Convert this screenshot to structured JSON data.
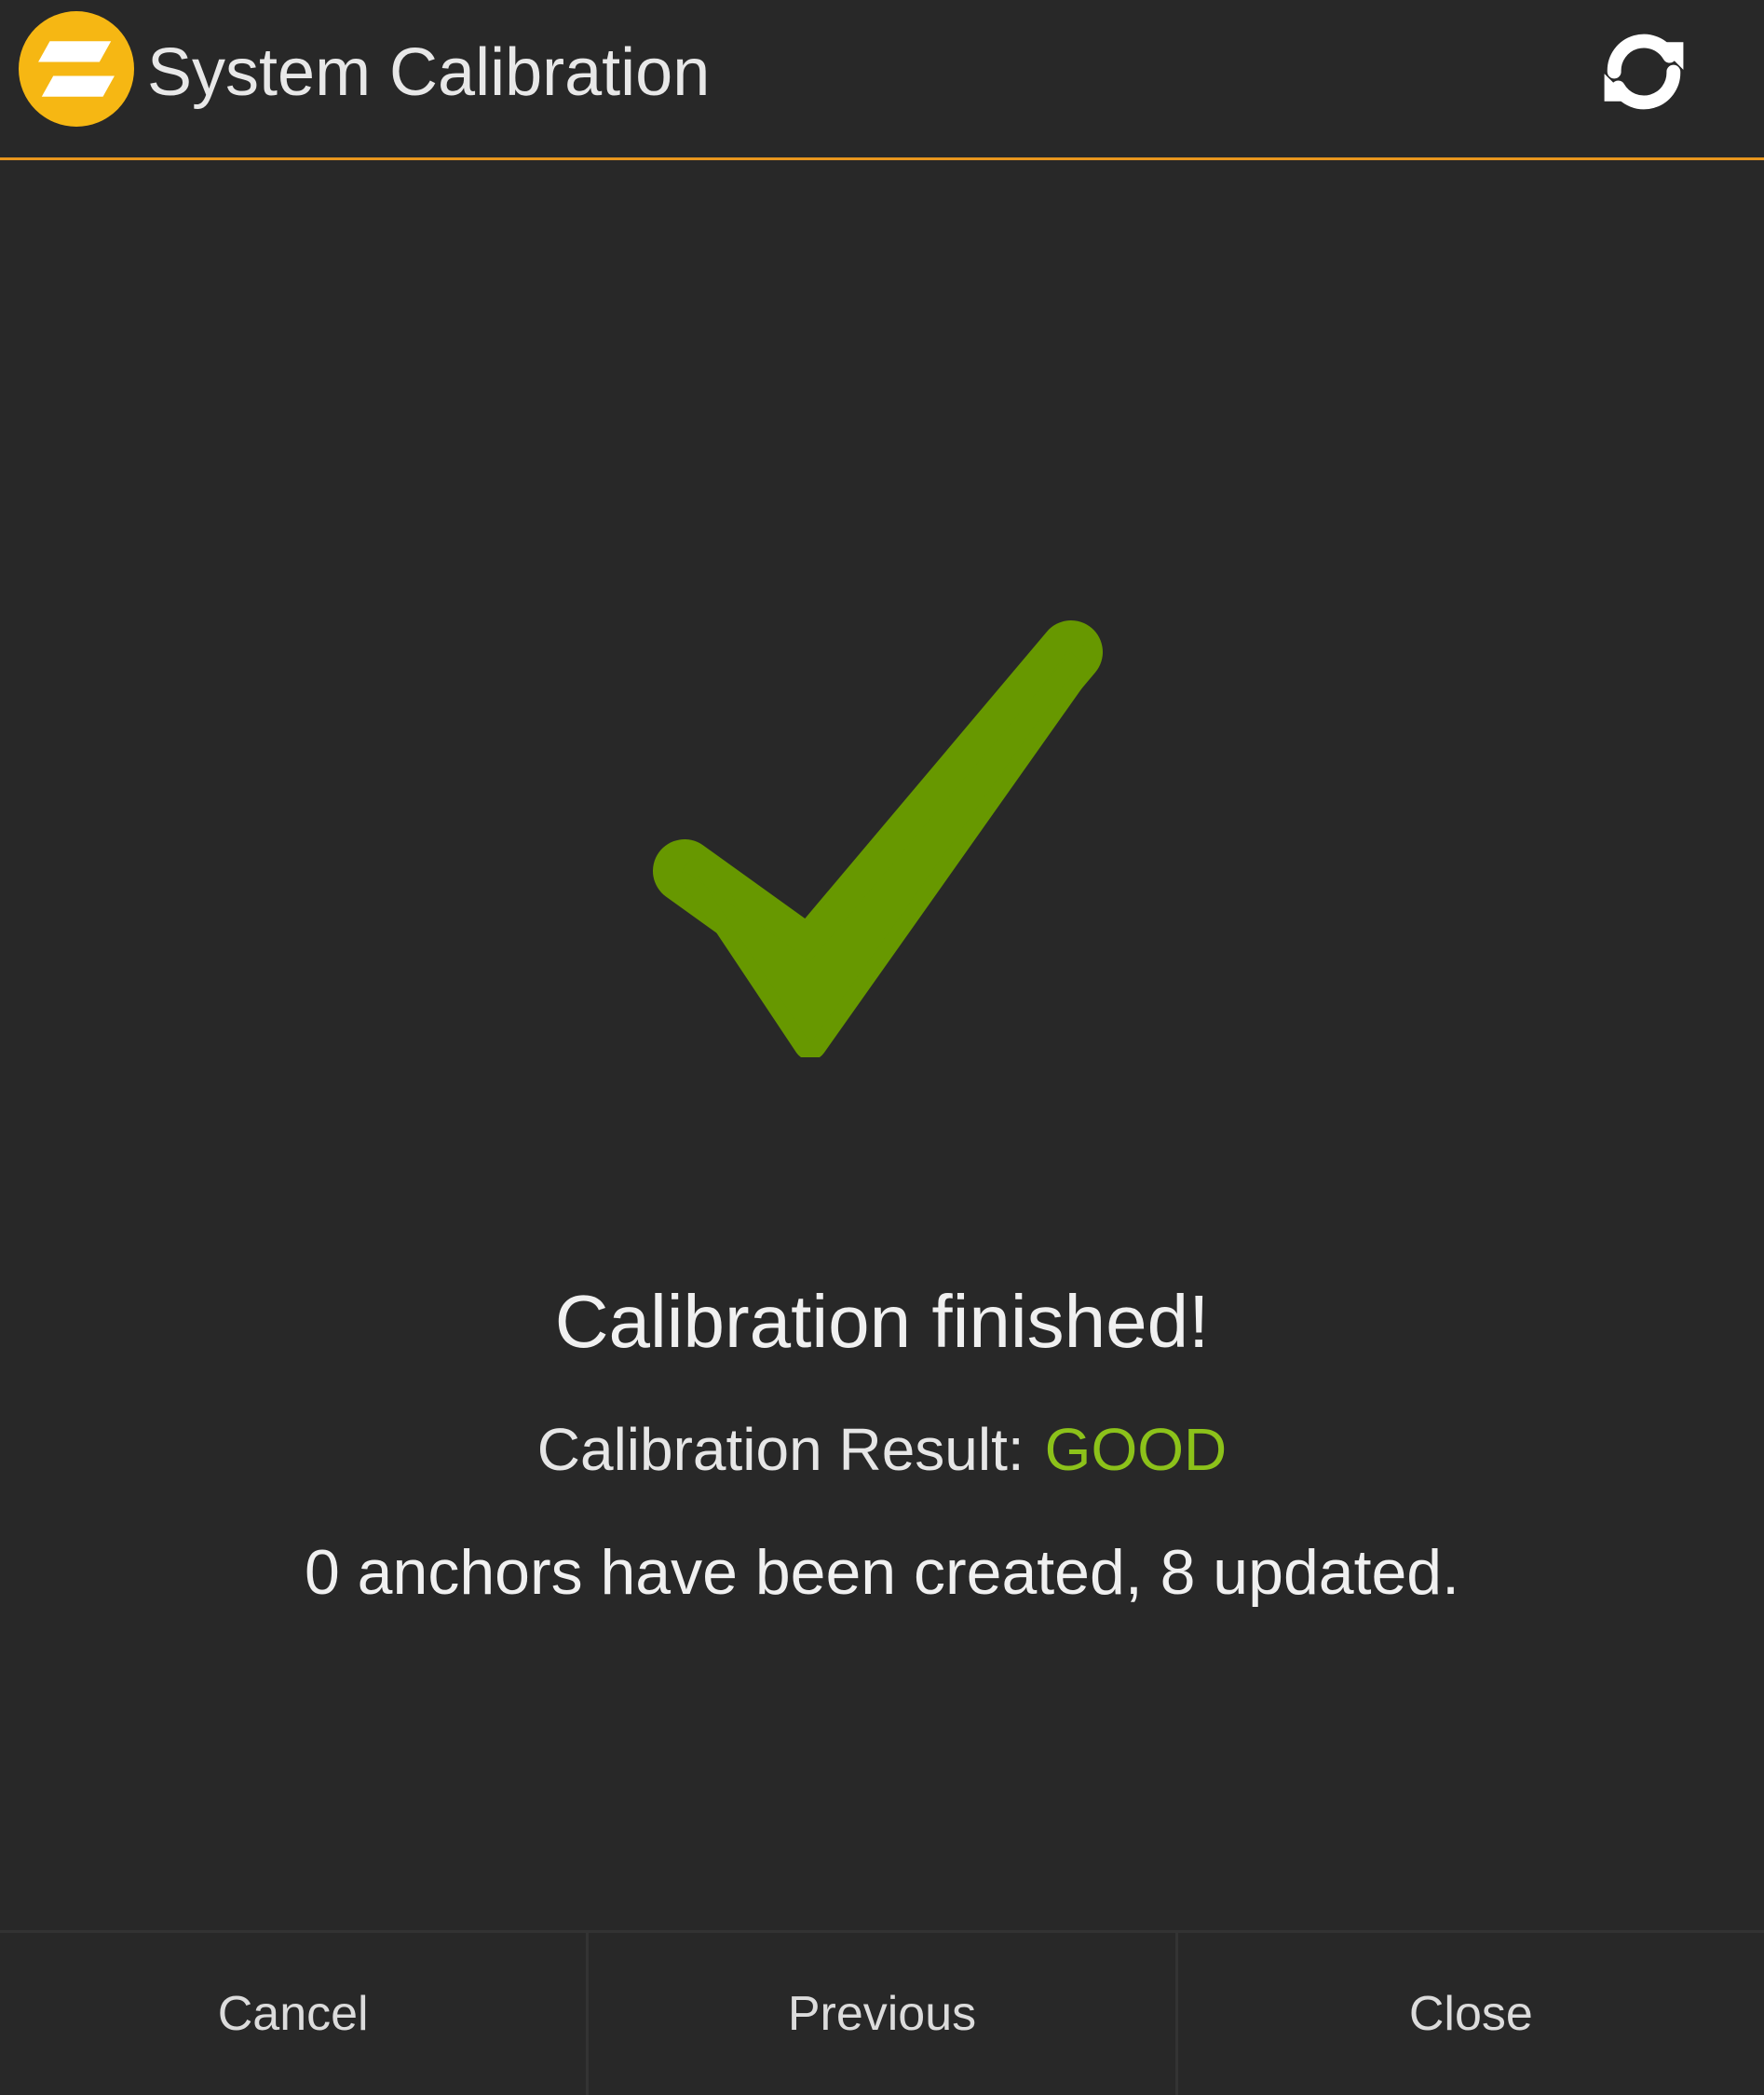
{
  "header": {
    "title": "System Calibration",
    "logo_icon": "calibration-logo-icon",
    "refresh_icon": "refresh-icon",
    "accent_color": "#e8961e"
  },
  "status": {
    "icon": "check-icon",
    "icon_color": "#679800",
    "headline": "Calibration finished!",
    "result_label": "Calibration Result:",
    "result_value": "GOOD",
    "result_color": "#8cc21a",
    "anchors_message": "0 anchors have been created, 8 updated."
  },
  "footer": {
    "cancel_label": "Cancel",
    "previous_label": "Previous",
    "close_label": "Close"
  }
}
